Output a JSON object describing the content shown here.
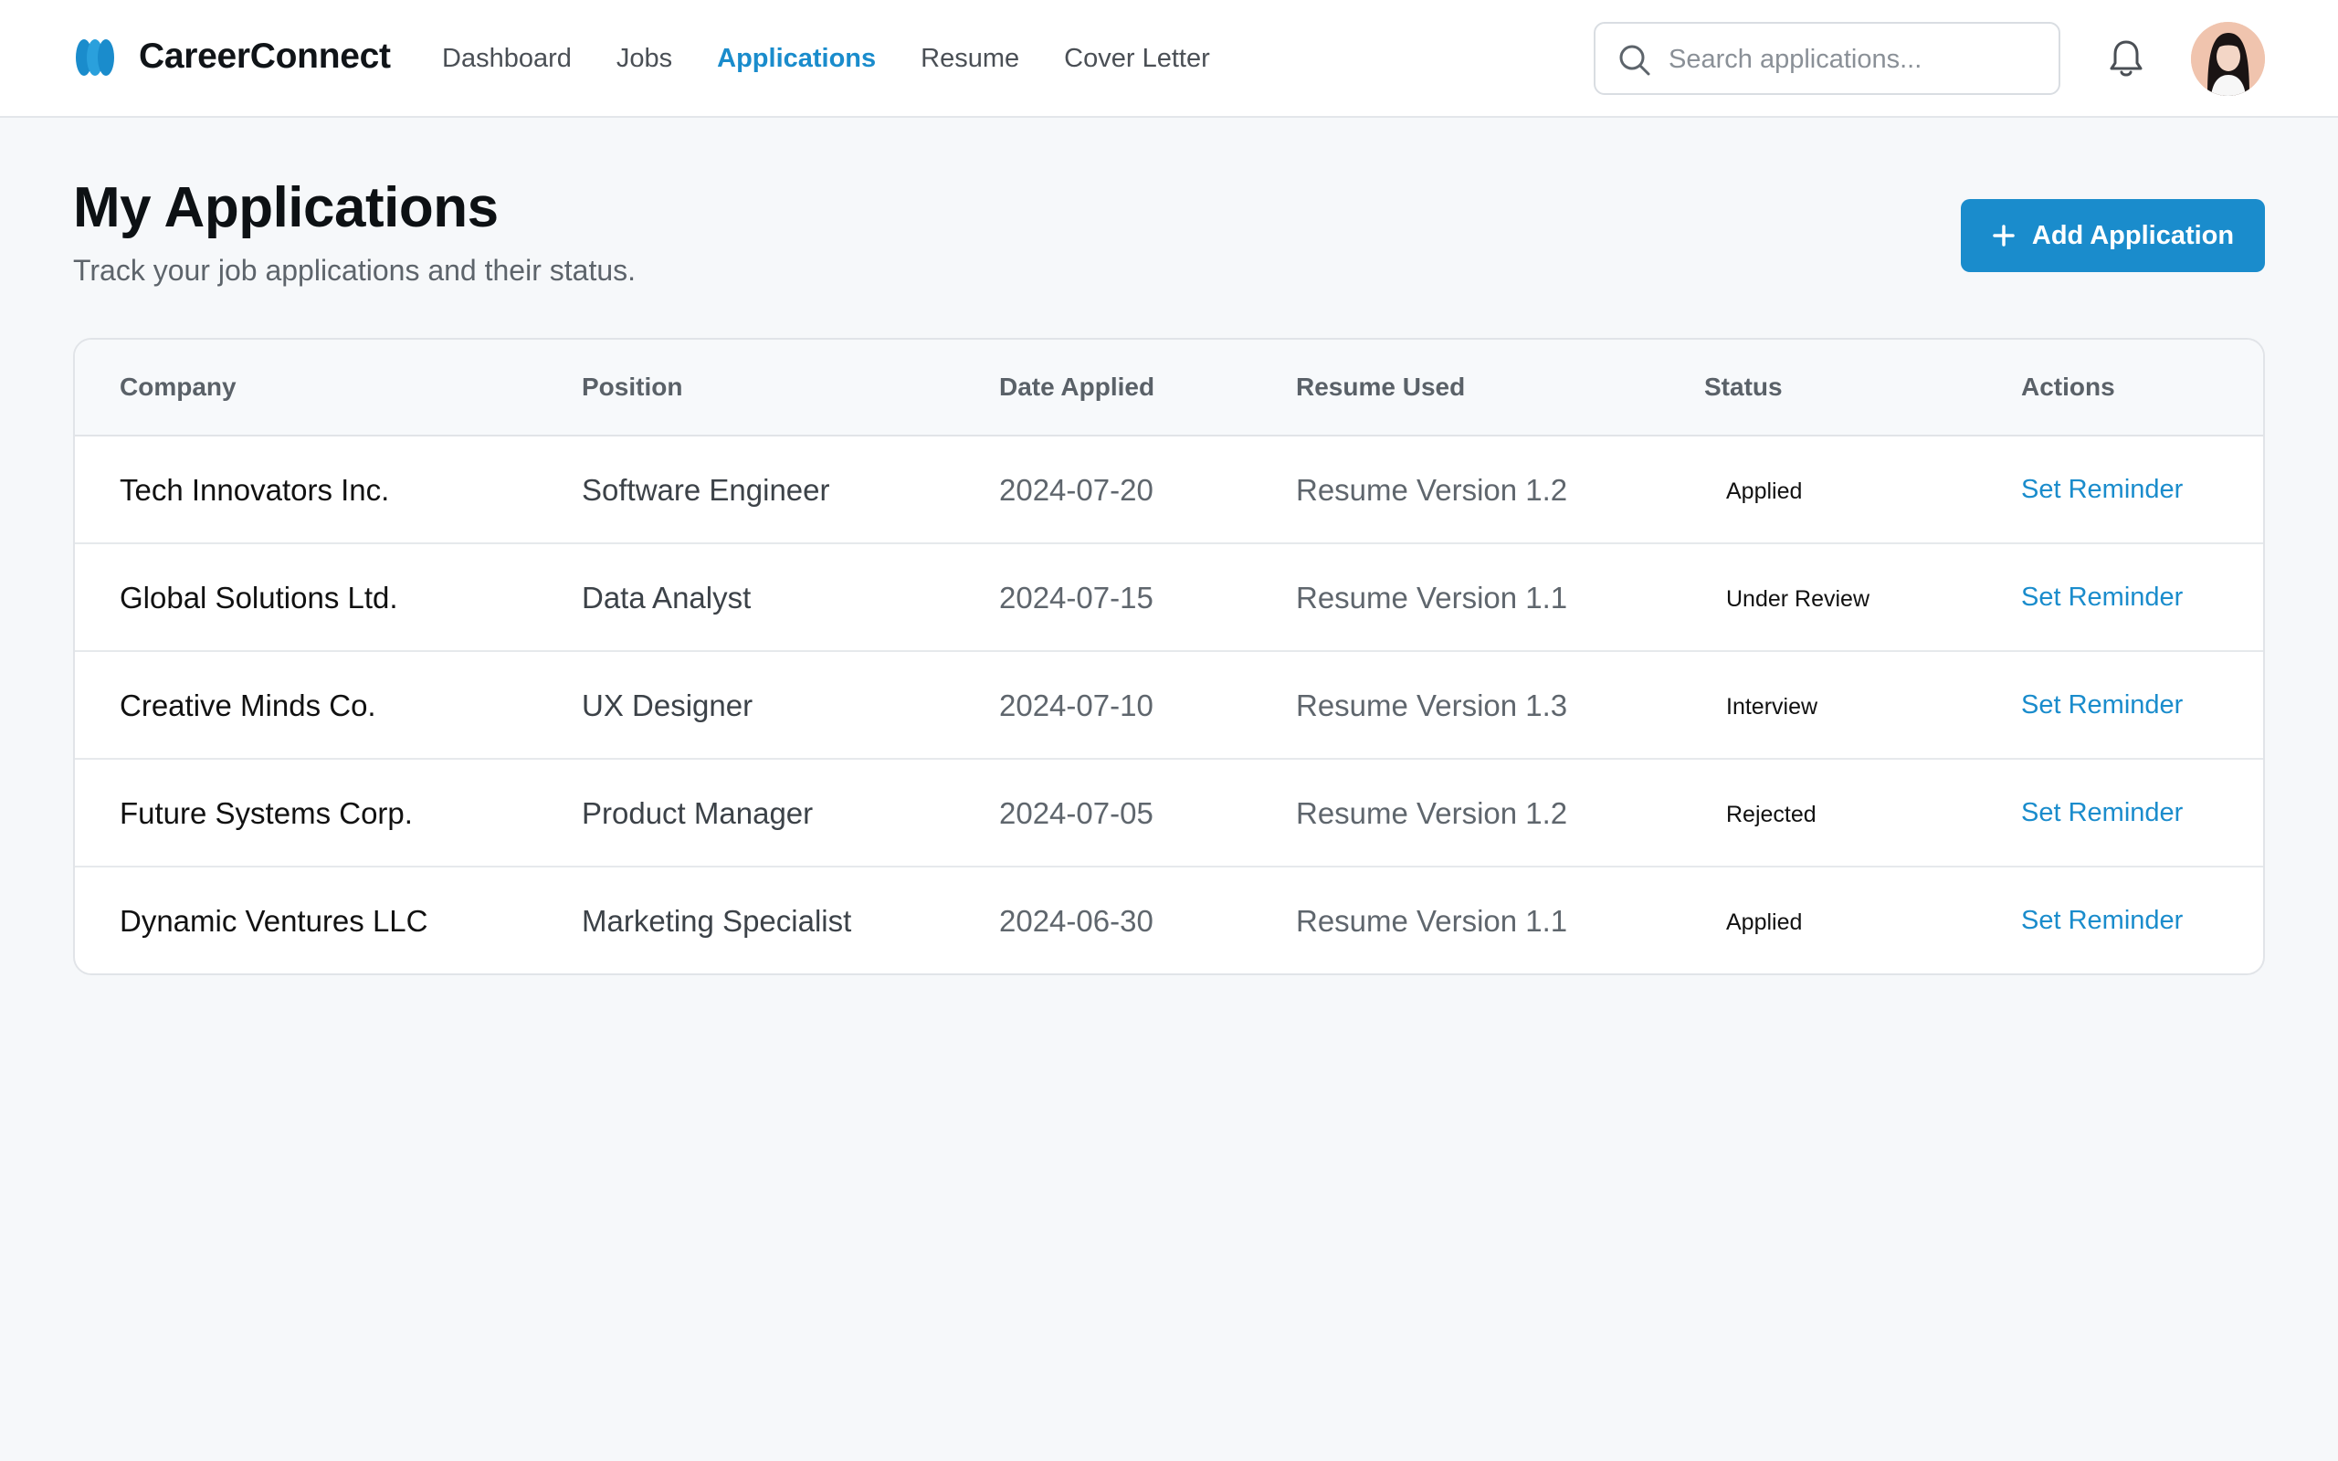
{
  "app": {
    "name": "CareerConnect"
  },
  "nav": {
    "items": [
      {
        "label": "Dashboard",
        "active": false
      },
      {
        "label": "Jobs",
        "active": false
      },
      {
        "label": "Applications",
        "active": true
      },
      {
        "label": "Resume",
        "active": false
      },
      {
        "label": "Cover Letter",
        "active": false
      }
    ]
  },
  "search": {
    "placeholder": "Search applications...",
    "value": ""
  },
  "header": {
    "title": "My Applications",
    "subtitle": "Track your job applications and their status.",
    "add_button_label": "Add Application"
  },
  "table": {
    "columns": [
      "Company",
      "Position",
      "Date Applied",
      "Resume Used",
      "Status",
      "Actions"
    ],
    "rows": [
      {
        "company": "Tech Innovators Inc.",
        "position": "Software Engineer",
        "date": "2024-07-20",
        "resume": "Resume Version 1.2",
        "status": "Applied",
        "action": "Set Reminder"
      },
      {
        "company": "Global Solutions Ltd.",
        "position": "Data Analyst",
        "date": "2024-07-15",
        "resume": "Resume Version 1.1",
        "status": "Under Review",
        "action": "Set Reminder"
      },
      {
        "company": "Creative Minds Co.",
        "position": "UX Designer",
        "date": "2024-07-10",
        "resume": "Resume Version 1.3",
        "status": "Interview",
        "action": "Set Reminder"
      },
      {
        "company": "Future Systems Corp.",
        "position": "Product Manager",
        "date": "2024-07-05",
        "resume": "Resume Version 1.2",
        "status": "Rejected",
        "action": "Set Reminder"
      },
      {
        "company": "Dynamic Ventures LLC",
        "position": "Marketing Specialist",
        "date": "2024-06-30",
        "resume": "Resume Version 1.1",
        "status": "Applied",
        "action": "Set Reminder"
      }
    ]
  },
  "icons": {
    "logo": "brand-logo-icon",
    "search": "search-icon",
    "notifications": "bell-icon",
    "add": "plus-icon"
  },
  "colors": {
    "accent": "#1a8ccc",
    "background": "#f6f8fa",
    "surface": "#ffffff",
    "border": "#e1e4e8"
  }
}
